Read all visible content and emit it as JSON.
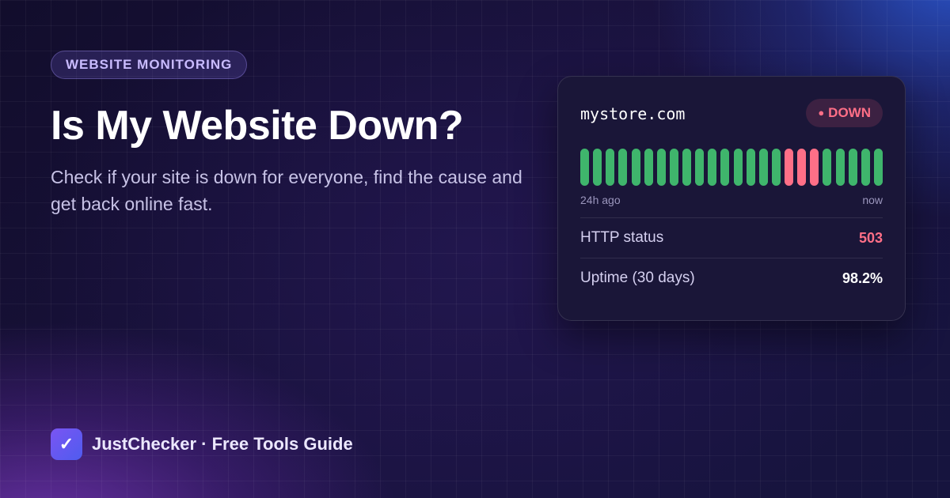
{
  "badge": "WEBSITE MONITORING",
  "title": "Is My Website Down?",
  "subtitle": "Check if your site is down for everyone, find the cause and get back online fast.",
  "brand": {
    "logo_glyph": "✓",
    "text": "JustChecker · Free Tools Guide"
  },
  "card": {
    "domain": "mystore.com",
    "status": {
      "dot": "●",
      "label": "DOWN"
    },
    "history": [
      "up",
      "up",
      "up",
      "up",
      "up",
      "up",
      "up",
      "up",
      "up",
      "up",
      "up",
      "up",
      "up",
      "up",
      "up",
      "up",
      "down",
      "down",
      "down",
      "up",
      "up",
      "up",
      "up",
      "up"
    ],
    "history_start_label": "24h ago",
    "history_end_label": "now",
    "rows": [
      {
        "label": "HTTP status",
        "value": "503"
      },
      {
        "label": "Uptime (30 days)",
        "value": "98.2%"
      }
    ]
  },
  "colors": {
    "up": "#3fb56c",
    "down": "#ff6f87",
    "accent": "#7a55f2"
  }
}
